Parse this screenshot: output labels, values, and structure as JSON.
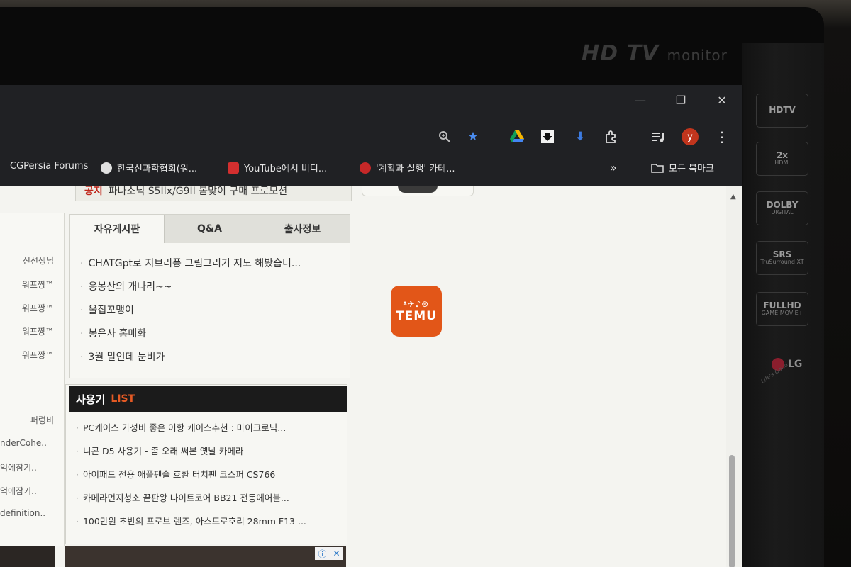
{
  "monitor": {
    "brand": "HD TV",
    "brand_suffix": "monitor",
    "badges": [
      {
        "main": "HDTV",
        "sub": ""
      },
      {
        "main": "2x",
        "sub": "HDMI"
      },
      {
        "main": "DOLBY",
        "sub": "DIGITAL"
      },
      {
        "main": "SRS",
        "sub": "TruSurround XT"
      },
      {
        "main": "FULLHD",
        "sub": "GAME MOVIE+"
      }
    ],
    "logo": "LG",
    "tagline": "Life's Good"
  },
  "window": {
    "minimize": "—",
    "restore": "❐",
    "close": "✕"
  },
  "toolbar": {
    "profile_initial": "y"
  },
  "bookmarks": {
    "items": [
      {
        "label": "CGPersia Forums",
        "icon_color": "#c0392b"
      },
      {
        "label": "한국신과학협회(워...",
        "icon_color": "#e0e0e0"
      },
      {
        "label": "YouTube에서 비디...",
        "icon_color": "#d32f2f"
      },
      {
        "label": "'계획과 실행' 카테...",
        "icon_color": "#c62828"
      }
    ],
    "overflow": "»",
    "all_bookmarks": "모든 북마크"
  },
  "left_column": {
    "names": [
      "신선생님",
      "워프짱™",
      "워프짱™",
      "워프짱™",
      "워프짱™"
    ],
    "name2": "퍼렁비",
    "partials": [
      "nderCohe..",
      "억에잠기..",
      "억에잠기..",
      "definition.."
    ]
  },
  "notice": {
    "tag": "공지",
    "text": "파나소닉 S5IIx/G9II 봄맞이 구매 프로모션"
  },
  "board": {
    "tabs": [
      "자유게시판",
      "Q&A",
      "출사정보"
    ],
    "posts": [
      "CHATGpt로 지브리풍 그림그리기 저도 해봤습니...",
      "응봉산의 개나리~~",
      "울집꼬맹이",
      "봉은사 홍매화",
      "3월 말인데 눈비가"
    ]
  },
  "reviews": {
    "title": "사용기",
    "list_label": "LIST",
    "items": [
      "PC케이스 가성비 좋은 어항 케이스추천 : 마이크로닉...",
      "니콘 D5 사용기 - 좀 오래 써본 옛날 카메라",
      "아이패드 전용 애플펜슬 호환 터치펜 코스퍼 CS766",
      "카메라먼지청소 끝판왕 나이트코어 BB21 전동에어블...",
      "100만원 초반의 프로브 렌즈, 아스트로호리 28mm F13 ..."
    ]
  },
  "ad": {
    "info": "ⓘ",
    "close": "✕"
  },
  "temu": {
    "glyphs": "ᵜ✈♪⊛",
    "word": "TEMU"
  },
  "colors": {
    "accent": "#e45a24",
    "temu": "#e25618",
    "notice_tag": "#c0271c",
    "star": "#4a8cf0"
  }
}
